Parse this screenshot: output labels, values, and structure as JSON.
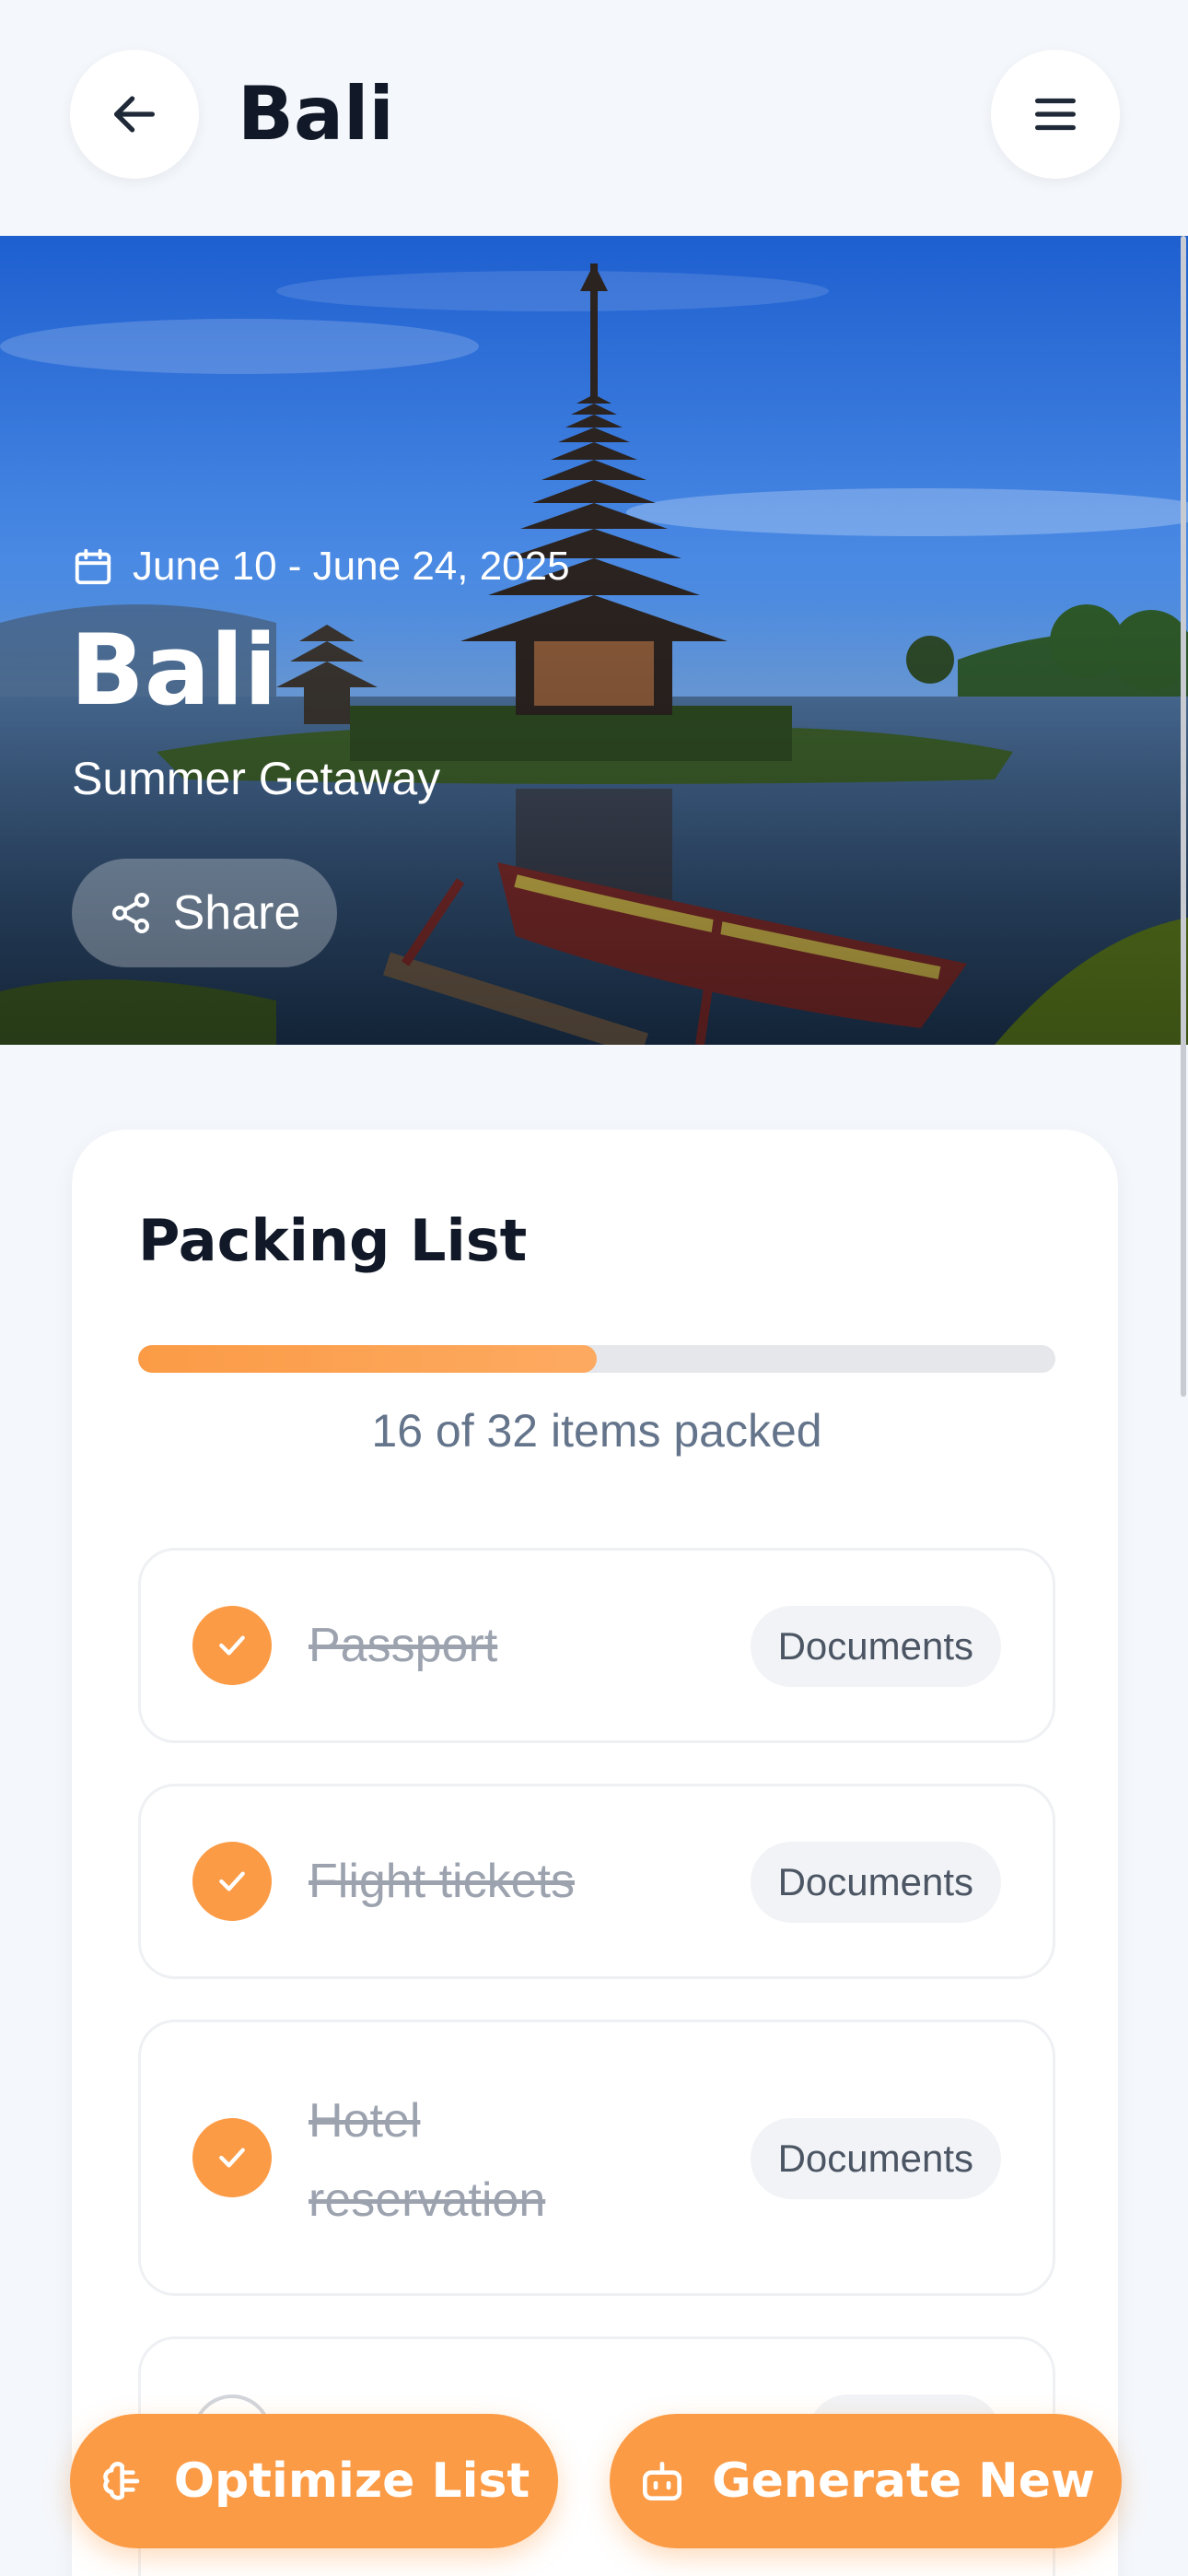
{
  "header": {
    "title": "Bali",
    "back_icon": "arrow-left-icon",
    "menu_icon": "menu-icon"
  },
  "hero": {
    "date": "June 10 - June 24, 2025",
    "title": "Bali",
    "subtitle": "Summer Getaway",
    "share_label": "Share"
  },
  "packing": {
    "title": "Packing List",
    "progress_fraction": 0.5,
    "progress_text": "16 of 32 items packed",
    "items": [
      {
        "name": "Passport",
        "tag": "Documents",
        "packed": true
      },
      {
        "name": "Flight tickets",
        "tag": "Documents",
        "packed": true
      },
      {
        "name": "Hotel reservation",
        "tag": "Documents",
        "packed": true
      }
    ]
  },
  "actions": {
    "optimize_label": "Optimize List",
    "generate_label": "Generate New"
  },
  "colors": {
    "accent": "#fb9b46",
    "background": "#f4f7fb",
    "card": "#ffffff"
  }
}
